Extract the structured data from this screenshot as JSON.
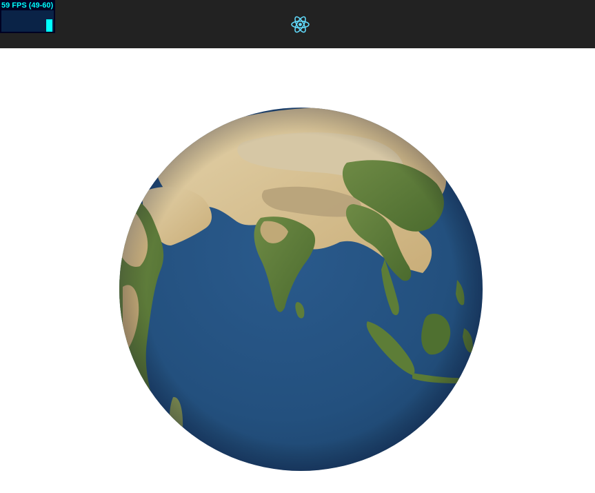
{
  "stats": {
    "fps_label": "59 FPS (49-60)",
    "fps_current": 59,
    "fps_min": 49,
    "fps_max": 60,
    "bar_color": "#00ffff",
    "bg_color": "#000022"
  },
  "header": {
    "logo_icon": "react-logo-icon",
    "logo_color": "#61dafb",
    "bg_color": "#222222"
  },
  "scene": {
    "object": "earth-globe",
    "ocean_color": "#23507e",
    "land_color": "#5c7c38",
    "desert_color": "#d8c49a"
  }
}
